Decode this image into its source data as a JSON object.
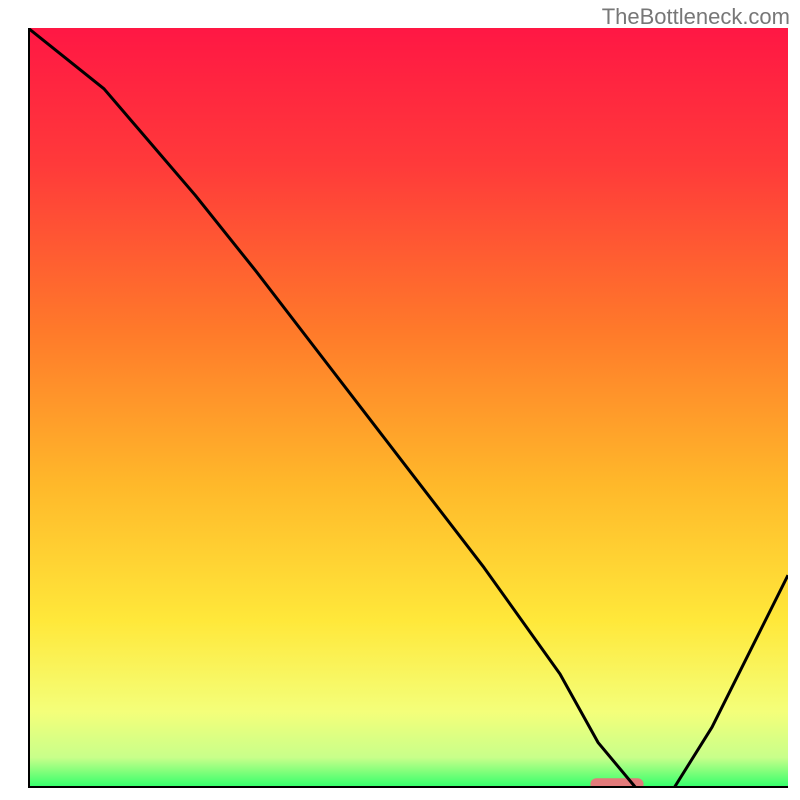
{
  "watermark": "TheBottleneck.com",
  "chart_data": {
    "type": "line",
    "title": "",
    "xlabel": "",
    "ylabel": "",
    "xlim": [
      0,
      100
    ],
    "ylim": [
      0,
      100
    ],
    "x": [
      0,
      10,
      22,
      30,
      40,
      50,
      60,
      70,
      75,
      80,
      85,
      90,
      100
    ],
    "values": [
      100,
      92,
      78,
      68,
      55,
      42,
      29,
      15,
      6,
      0,
      0,
      8,
      28
    ],
    "gradient_stops": [
      {
        "offset": 0,
        "color": "#ff1744"
      },
      {
        "offset": 0.18,
        "color": "#ff3a3a"
      },
      {
        "offset": 0.4,
        "color": "#ff7a2a"
      },
      {
        "offset": 0.6,
        "color": "#ffb82a"
      },
      {
        "offset": 0.78,
        "color": "#ffe83a"
      },
      {
        "offset": 0.9,
        "color": "#f4ff7a"
      },
      {
        "offset": 0.96,
        "color": "#c8ff8a"
      },
      {
        "offset": 1.0,
        "color": "#2eff6a"
      }
    ],
    "marker": {
      "x_start": 74,
      "x_end": 81,
      "y": 0.5,
      "color": "#e27a7a"
    },
    "axis_color": "#000000",
    "line_color": "#000000"
  }
}
